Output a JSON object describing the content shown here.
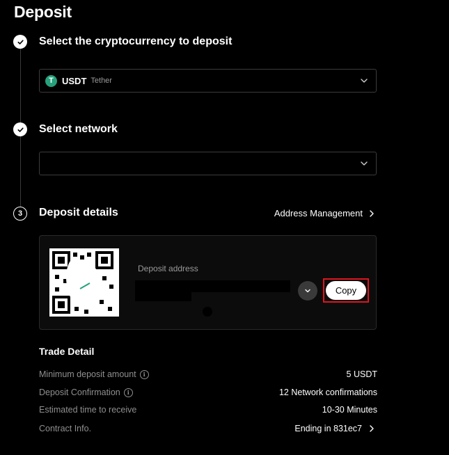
{
  "page": {
    "title": "Deposit"
  },
  "steps": [
    {
      "number": "1",
      "status": "done",
      "title": "Select the cryptocurrency to deposit"
    },
    {
      "number": "2",
      "status": "done",
      "title": "Select network"
    },
    {
      "number": "3",
      "status": "current",
      "title": "Deposit details"
    }
  ],
  "crypto_select": {
    "symbol": "USDT",
    "name": "Tether",
    "logo_letter": "T",
    "logo_color": "#26a17b"
  },
  "network_select": {
    "value_redacted": true
  },
  "address_management": {
    "label": "Address Management"
  },
  "deposit_card": {
    "address_label": "Deposit address",
    "address_redacted": true,
    "copy_label": "Copy",
    "highlight_color": "#e0141e"
  },
  "trade_detail": {
    "title": "Trade Detail",
    "rows": [
      {
        "label": "Minimum deposit amount",
        "value": "5 USDT",
        "has_info_icon": true
      },
      {
        "label": "Deposit Confirmation",
        "value": "12 Network confirmations",
        "has_info_icon": true
      },
      {
        "label": "Estimated time to receive",
        "value": "10-30 Minutes",
        "has_info_icon": false
      },
      {
        "label": "Contract Info.",
        "value": "Ending in 831ec7",
        "has_chevron": true
      }
    ]
  },
  "icons": {
    "step_done": "check-icon",
    "dropdown": "chevron-down-icon",
    "link": "chevron-right-icon",
    "info": "info-icon"
  }
}
